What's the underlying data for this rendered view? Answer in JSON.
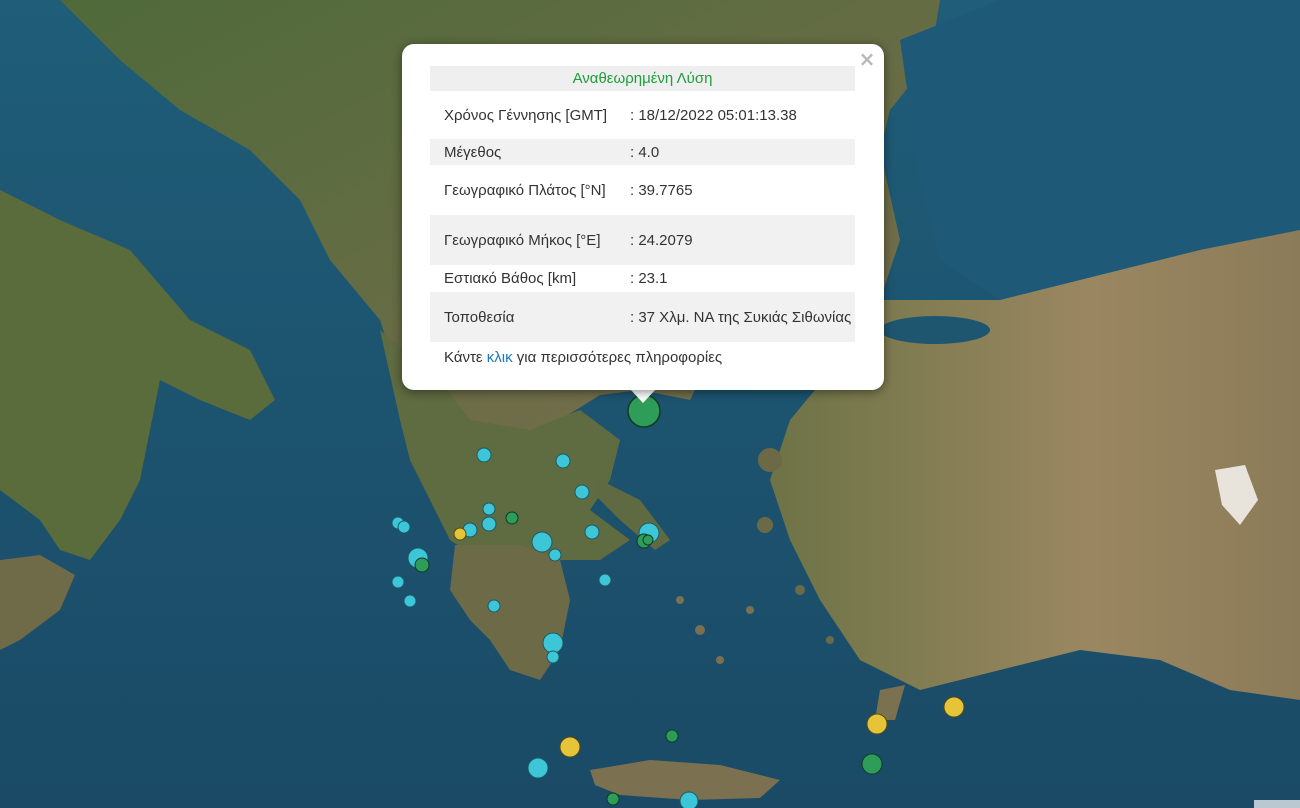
{
  "popup": {
    "header": "Αναθεωρημένη Λύση",
    "close_symbol": "×",
    "rows": [
      {
        "label": "Χρόνος Γέννησης [GMT]",
        "value": ": 18/12/2022 05:01:13.38"
      },
      {
        "label": "Μέγεθος",
        "value": ": 4.0"
      },
      {
        "label": "Γεωγραφικό Πλάτος [°N]",
        "value": ": 39.7765"
      },
      {
        "label": "Γεωγραφικό Μήκος [°E]",
        "value": ": 24.2079"
      },
      {
        "label": "Εστιακό Βάθος [km]",
        "value": ": 23.1"
      },
      {
        "label": "Τοποθεσία",
        "value": ": 37 Χλμ. ΝΑ της Συκιάς Σιθωνίας"
      }
    ],
    "more_prefix": "Κάντε ",
    "more_link": "κλικ",
    "more_suffix": " για περισσότερες πληροφορίες"
  },
  "colors": {
    "marker_cyan": "#3cc6d8",
    "marker_green": "#2e9d5a",
    "marker_yellow": "#e5c43a",
    "selected_marker": "#2e9d5a",
    "header_text": "#1e9d3a",
    "link": "#1b7ac4"
  }
}
